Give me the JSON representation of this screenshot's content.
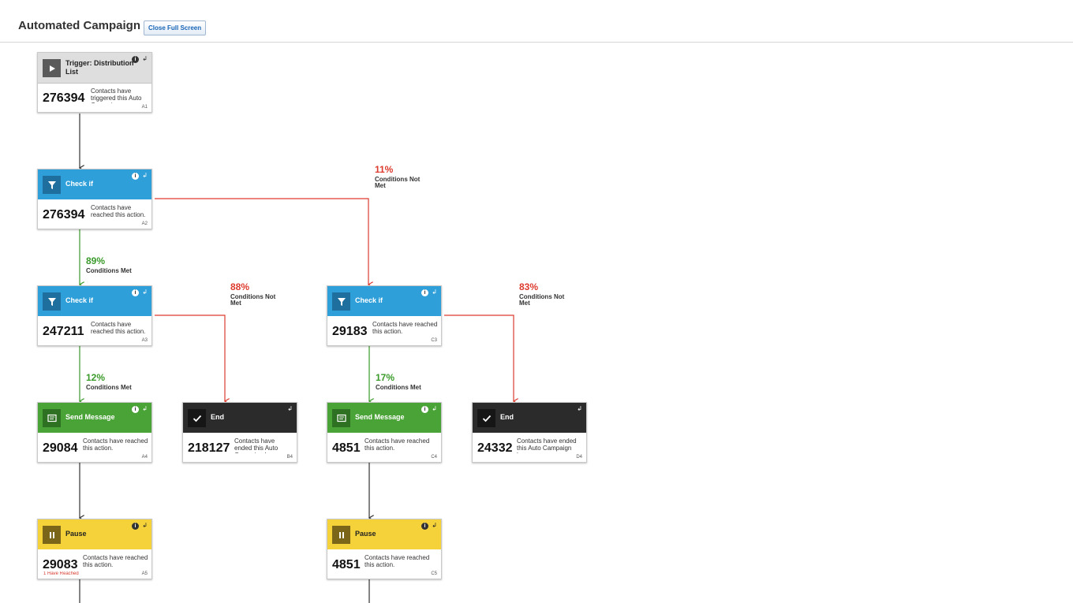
{
  "header": {
    "title": "Automated Campaign",
    "close_label": "Close Full Screen"
  },
  "colors": {
    "met_line": "#3a9a2a",
    "not_met_line": "#dd3b2e",
    "flow_line": "#333333",
    "check_header": "#2e9fd9",
    "send_header": "#4aa336",
    "end_header": "#2b2b2b",
    "pause_header": "#f6d23a"
  },
  "nodes": {
    "a1": {
      "label": "Trigger: Distribution List",
      "icon": "play-icon",
      "count": "276394",
      "desc": "Contacts have triggered this Auto Campaign",
      "code": "A1"
    },
    "a2": {
      "label": "Check if",
      "icon": "filter-icon",
      "count": "276394",
      "desc": "Contacts have reached this action.",
      "code": "A2"
    },
    "a3": {
      "label": "Check if",
      "icon": "filter-icon",
      "count": "247211",
      "desc": "Contacts have reached this action.",
      "code": "A3"
    },
    "c3": {
      "label": "Check if",
      "icon": "filter-icon",
      "count": "29183",
      "desc": "Contacts have reached this action.",
      "code": "C3"
    },
    "a4": {
      "label": "Send Message",
      "icon": "message-icon",
      "count": "29084",
      "desc": "Contacts have reached this action.",
      "code": "A4"
    },
    "b4": {
      "label": "End",
      "icon": "check-icon",
      "count": "218127",
      "desc": "Contacts have ended this Auto Campaign here",
      "code": "B4"
    },
    "c4": {
      "label": "Send Message",
      "icon": "message-icon",
      "count": "4851",
      "desc": "Contacts have reached this action.",
      "code": "C4"
    },
    "d4": {
      "label": "End",
      "icon": "check-icon",
      "count": "24332",
      "desc": "Contacts have ended this Auto Campaign here",
      "code": "D4"
    },
    "a5": {
      "label": "Pause",
      "icon": "pause-icon",
      "count": "29083",
      "desc": "Contacts have reached this action.",
      "code": "A5",
      "sub": "1 Have Reached"
    },
    "c5": {
      "label": "Pause",
      "icon": "pause-icon",
      "count": "4851",
      "desc": "Contacts have reached this action.",
      "code": "C5"
    }
  },
  "branches": {
    "a2_met": {
      "pct": "89%",
      "text": "Conditions Met"
    },
    "a2_notmet": {
      "pct": "11%",
      "text": "Conditions Not Met"
    },
    "a3_met": {
      "pct": "12%",
      "text": "Conditions Met"
    },
    "a3_notmet": {
      "pct": "88%",
      "text": "Conditions Not Met"
    },
    "c3_met": {
      "pct": "17%",
      "text": "Conditions Met"
    },
    "c3_notmet": {
      "pct": "83%",
      "text": "Conditions Not Met"
    }
  }
}
